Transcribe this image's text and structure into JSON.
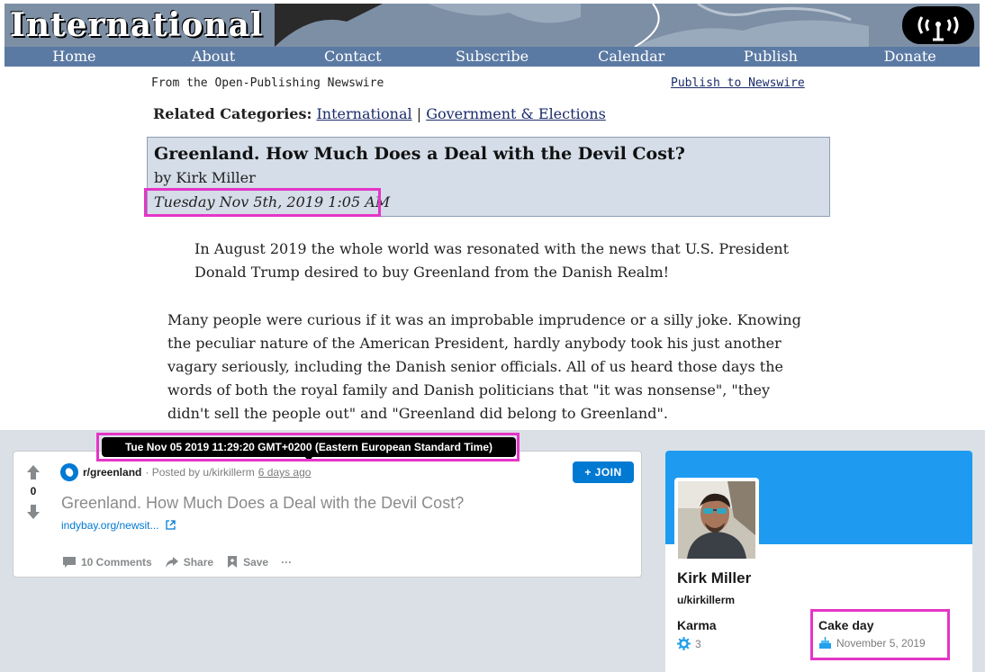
{
  "header": {
    "site_title": "International",
    "nav": [
      "Home",
      "About",
      "Contact",
      "Subscribe",
      "Calendar",
      "Publish",
      "Donate"
    ]
  },
  "article": {
    "source_note": "From the Open-Publishing Newswire",
    "publish_link": "Publish to Newswire",
    "related_label": "Related Categories:",
    "categories": [
      "International",
      "Government & Elections"
    ],
    "category_separator": "|",
    "title": "Greenland. How Much Does a Deal with the Devil Cost?",
    "byline": "by Kirk Miller",
    "date": "Tuesday Nov 5th, 2019 1:05 AM",
    "paragraph1": "In August 2019 the whole world was resonated with the news that U.S. President Donald Trump desired to buy Greenland from the Danish Realm!",
    "paragraph2": "Many people were curious if it was an improbable imprudence or a silly joke. Knowing the peculiar nature of the American President, hardly anybody took his just another vagary seriously, including the Danish senior officials. All of us heard those days the words of both the royal family and Danish politicians that \"it was nonsense\", \"they didn't sell the people out\" and \"Greenland did belong to Greenland\"."
  },
  "reddit": {
    "tooltip": "Tue Nov 05 2019 11:29:20 GMT+0200 (Eastern European Standard Time)",
    "post": {
      "vote_count": "0",
      "subreddit": "r/greenland",
      "posted_by": "· Posted by u/kirkillerm",
      "age": "6 days ago",
      "join_label": "+ JOIN",
      "title": "Greenland. How Much Does a Deal with the Devil Cost?",
      "link": "indybay.org/newsit...",
      "comments": "10 Comments",
      "share": "Share",
      "save": "Save",
      "more": "···"
    },
    "profile": {
      "name": "Kirk Miller",
      "handle": "u/kirkillerm",
      "karma_label": "Karma",
      "karma_value": "3",
      "cake_label": "Cake day",
      "cake_value": "November 5, 2019"
    }
  },
  "colors": {
    "highlight": "#e535c8",
    "nav_bar": "#5b7aa3",
    "reddit_blue": "#0079d3"
  }
}
